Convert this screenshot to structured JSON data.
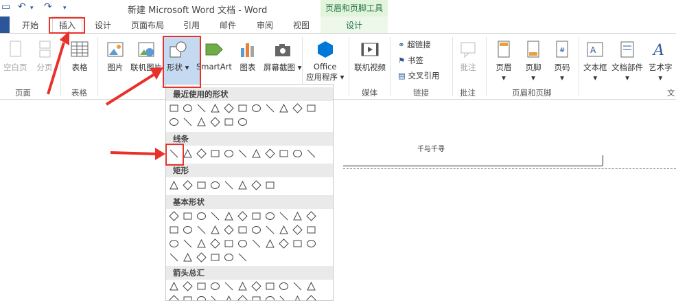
{
  "titlebar": {
    "title": "新建 Microsoft Word 文档 - Word",
    "context_header": "页眉和页脚工具"
  },
  "tabs": [
    "开始",
    "插入",
    "设计",
    "页面布局",
    "引用",
    "邮件",
    "审阅",
    "视图"
  ],
  "context_tab": "设计",
  "ribbon": {
    "blank_page": "空白页",
    "page_break": "分页",
    "table": "表格",
    "picture": "图片",
    "online_picture": "联机图片",
    "shapes": "形状",
    "smartart": "SmartArt",
    "chart": "图表",
    "screenshot": "屏幕截图",
    "office_apps_1": "Office",
    "office_apps_2": "应用程序",
    "online_video": "联机视频",
    "hyperlink": "超链接",
    "bookmark": "书签",
    "cross_ref": "交叉引用",
    "comment": "批注",
    "header": "页眉",
    "footer": "页脚",
    "page_number": "页码",
    "textbox": "文本框",
    "doc_parts": "文档部件",
    "wordart": "艺术字"
  },
  "groups": {
    "pages": "页面",
    "tables": "表格",
    "media": "媒体",
    "links": "链接",
    "comments": "批注",
    "header_footer": "页眉和页脚",
    "text": "文"
  },
  "gallery": {
    "recent": "最近使用的形状",
    "lines": "线条",
    "rectangles": "矩形",
    "basic": "基本形状",
    "arrows": "箭头总汇"
  },
  "document": {
    "header_text": "千与千寻"
  },
  "colors": {
    "accent": "#2b579a",
    "highlight": "#e8312b",
    "context": "#217346"
  }
}
